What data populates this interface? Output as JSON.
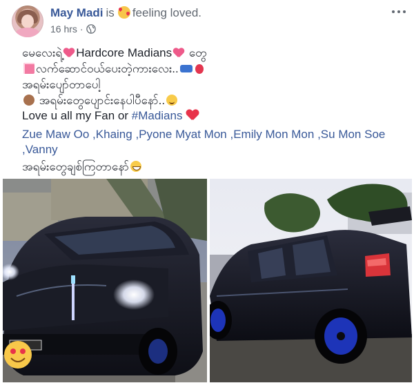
{
  "post": {
    "author": "May Madi",
    "is_word": "is",
    "feeling": "feeling loved.",
    "time": "16 hrs",
    "separator": "·",
    "lines": [
      "မေလေးရဲ့",
      "Hardcore Madians",
      "တွေ",
      "လက်ဆောင်ဝယ်ပေးတဲ့ကားလေး..",
      "အရမ်းပျော်တာပေါ့",
      "အရမ်းတွေပျောင်းနေပါပီနော်..",
      "Love u all my Fan or ",
      "#Madians",
      "အရမ်းတွေချစ်ကြတာနော်"
    ],
    "tags": [
      "Zue Maw Oo",
      ",Khaing",
      ",Pyone Myat Mon",
      ",Emily Mon Mon",
      ",Su Mon Soe",
      ",Vanny"
    ],
    "icons": {
      "feeling": "smiling-face-with-hearts-icon",
      "privacy": "globe-icon",
      "more": "more-options-icon"
    },
    "colors": {
      "link": "#385898",
      "secondary": "#606770",
      "heart": "#e8334a"
    }
  }
}
